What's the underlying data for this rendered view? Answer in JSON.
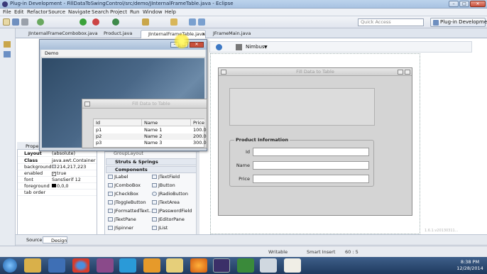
{
  "window": {
    "title": "Plug-in Development - FillDataToSwingControl/src/demo/JInternalFrameTable.java - Eclipse"
  },
  "menu": [
    "File",
    "Edit",
    "Refactor",
    "Source",
    "Navigate",
    "Search",
    "Project",
    "Run",
    "Window",
    "Help"
  ],
  "toolbar": {
    "quick_access": "Quick Access",
    "perspective": "Plug-in Development"
  },
  "editor_tabs": [
    "JInternalFrameCombobox.java",
    "Product.java",
    "JInternalFrameTable.java",
    "JFrameMain.java"
  ],
  "editor_toolbar": {
    "look_and_feel": "Nimbus"
  },
  "demo_frame": {
    "menu": "Demo"
  },
  "demo_internal": {
    "title": "Fill Data to Table"
  },
  "table": {
    "headers": [
      "Id",
      "Name",
      "Price"
    ],
    "rows": [
      [
        "p1",
        "Name 1",
        "100.0"
      ],
      [
        "p2",
        "Name 2",
        "200.0"
      ],
      [
        "p3",
        "Name 3",
        "300.0"
      ]
    ]
  },
  "design_frame": {
    "title": "Fill Data to Table",
    "group": "Product Information",
    "labels": [
      "Id",
      "Name",
      "Price"
    ],
    "version": "1.6.1.v20130311..."
  },
  "properties": {
    "tab": "Prope",
    "rows": [
      {
        "key": "Layout",
        "value": "(absolute)"
      },
      {
        "key": "Class",
        "value": "java.awt.Container"
      },
      {
        "key": "background",
        "value": "214,217,223"
      },
      {
        "key": "enabled",
        "value": "true"
      },
      {
        "key": "font",
        "value": "SansSerif 12"
      },
      {
        "key": "foreground",
        "value": "0,0,0"
      },
      {
        "key": "tab order",
        "value": ""
      }
    ]
  },
  "palette": {
    "partial": "GroupLayout",
    "categories": [
      "Struts & Springs",
      "Components"
    ],
    "items": [
      [
        "JLabel",
        "JTextField"
      ],
      [
        "JComboBox",
        "JButton"
      ],
      [
        "JCheckBox",
        "JRadioButton"
      ],
      [
        "JToggleButton",
        "JTextArea"
      ],
      [
        "JFormattedText...",
        "JPasswordField"
      ],
      [
        "JTextPane",
        "JEditorPane"
      ],
      [
        "JSpinner",
        "JList"
      ]
    ]
  },
  "source_tabs": [
    "Source",
    "Design"
  ],
  "status": {
    "writable": "Writable",
    "insert": "Smart Insert",
    "position": "60 : 5"
  },
  "clock": {
    "time": "8:38 PM",
    "date": "12/28/2014"
  }
}
